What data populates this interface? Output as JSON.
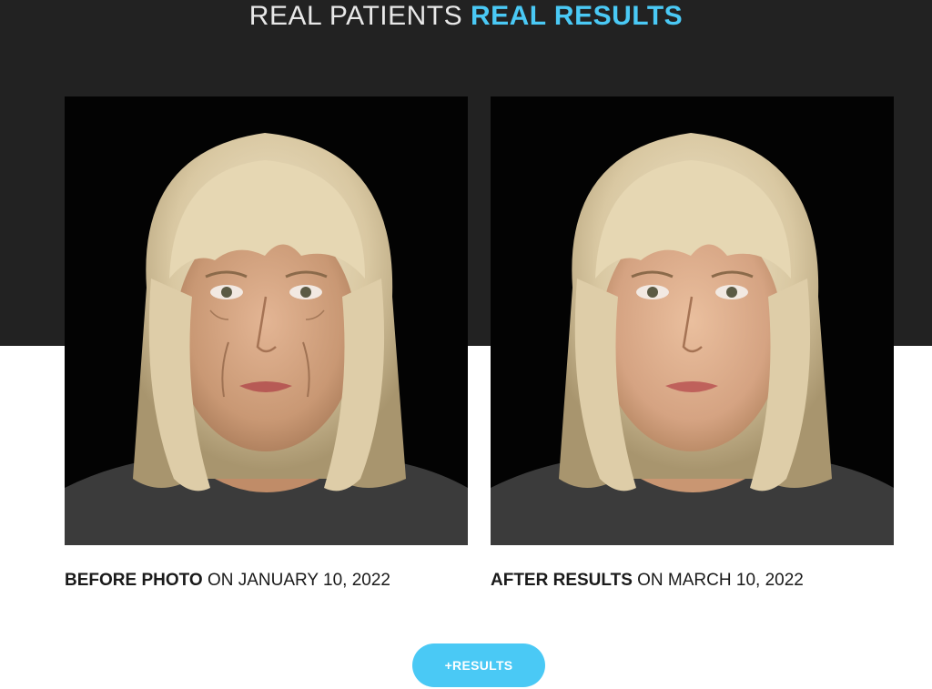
{
  "header": {
    "title_light": "REAL PATIENTS",
    "title_accent": "REAL RESULTS"
  },
  "gallery": {
    "before": {
      "label_strong": "BEFORE PHOTO",
      "label_rest": " ON JANUARY 10, 2022"
    },
    "after": {
      "label_strong": "AFTER RESULTS",
      "label_rest": " ON MARCH 10, 2022"
    }
  },
  "actions": {
    "more_results_label": "+RESULTS"
  },
  "colors": {
    "accent": "#4ac9f5",
    "dark_band": "#222222",
    "photo_background": "#030303",
    "text": "#1a1a1a"
  }
}
